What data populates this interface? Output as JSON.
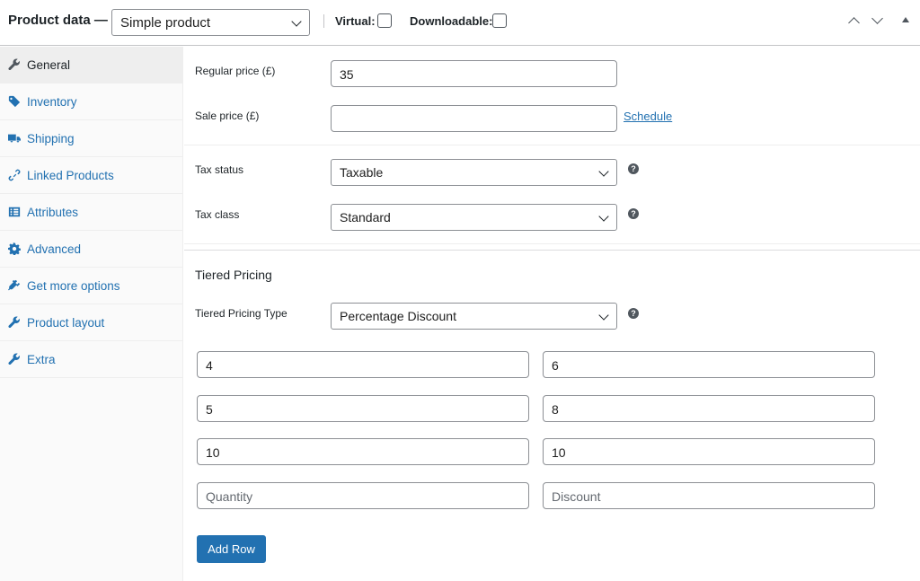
{
  "header": {
    "title": "Product data —",
    "product_type": "Simple product",
    "virtual_label": "Virtual:",
    "downloadable_label": "Downloadable:"
  },
  "sidebar": {
    "items": [
      {
        "label": "General",
        "icon": "wrench-icon",
        "active": true
      },
      {
        "label": "Inventory",
        "icon": "tag-icon"
      },
      {
        "label": "Shipping",
        "icon": "truck-icon"
      },
      {
        "label": "Linked Products",
        "icon": "link-icon"
      },
      {
        "label": "Attributes",
        "icon": "list-icon"
      },
      {
        "label": "Advanced",
        "icon": "gear-icon"
      },
      {
        "label": "Get more options",
        "icon": "plugin-icon"
      },
      {
        "label": "Product layout",
        "icon": "wrench-icon"
      },
      {
        "label": "Extra",
        "icon": "wrench-icon"
      }
    ]
  },
  "pricing": {
    "regular_label": "Regular price (£)",
    "regular_value": "35",
    "sale_label": "Sale price (£)",
    "sale_value": "",
    "schedule_link": "Schedule"
  },
  "tax": {
    "status_label": "Tax status",
    "status_value": "Taxable",
    "class_label": "Tax class",
    "class_value": "Standard"
  },
  "tiered": {
    "title": "Tiered Pricing",
    "type_label": "Tiered Pricing Type",
    "type_value": "Percentage Discount",
    "rows": [
      {
        "quantity": "4",
        "discount": "6"
      },
      {
        "quantity": "5",
        "discount": "8"
      },
      {
        "quantity": "10",
        "discount": "10"
      }
    ],
    "quantity_placeholder": "Quantity",
    "discount_placeholder": "Discount",
    "add_row_label": "Add Row"
  },
  "help_glyph": "?"
}
